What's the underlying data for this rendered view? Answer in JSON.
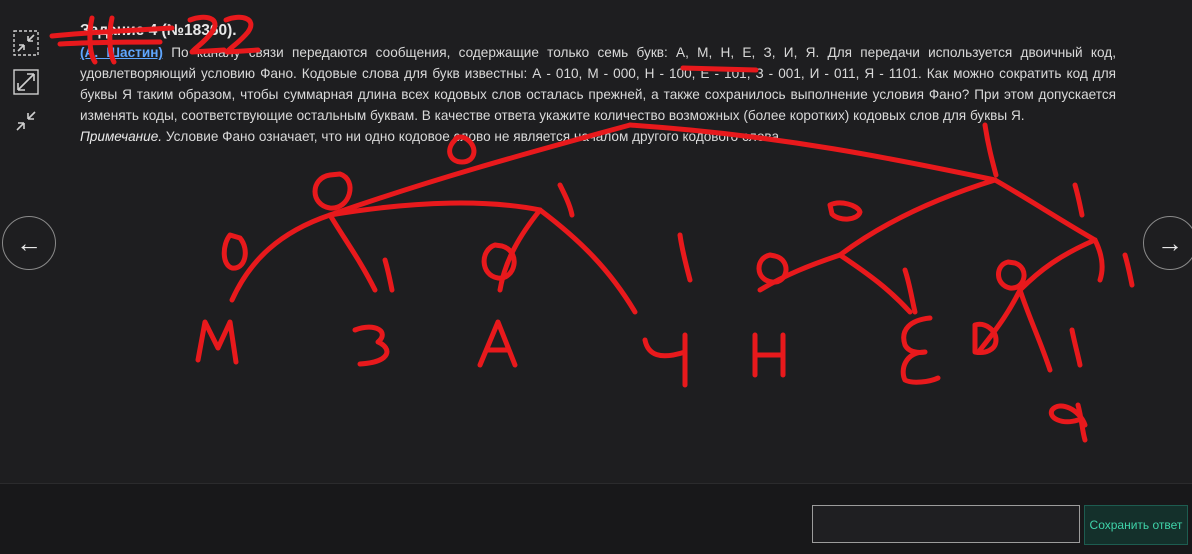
{
  "task": {
    "title": "Задание 4 (№18360).",
    "author": "(А. Шастин)",
    "text": " По каналу связи передаются сообщения, содержащие только семь букв: А, М, Н, Е, З, И, Я. Для передачи используется двоичный код, удовлетворяющий условию Фано. Кодовые слова для букв известны: А - 010, М - 000, Н - 100, Е - 101, З - 001, И - 011, Я - 1101. Как можно сократить код для буквы Я таким образом, чтобы суммарная длина всех кодовых слов осталась прежней, а также сохранилось выполнение условия Фано? При этом допускается изменять коды, соответствующие остальным буквам. В качестве ответа укажите количество возможных (более коротких) кодовых слов для буквы Я.",
    "note_label": "Примечание.",
    "note_text": " Условие Фано означает, что ни одно кодовое слово не является началом другого кодового слова."
  },
  "nav": {
    "prev": "←",
    "next": "→"
  },
  "answer": {
    "value": "",
    "placeholder": "",
    "save_label": "Сохранить ответ"
  },
  "tools": [
    "collapse-icon",
    "expand-icon",
    "shrink-icon"
  ],
  "annotations": {
    "top_left": "#22",
    "tree_labels": [
      "0",
      "1",
      "0",
      "1",
      "0",
      "1",
      "0",
      "1",
      "0",
      "1",
      "0",
      "1",
      "0",
      "1"
    ],
    "leaves": [
      "М",
      "З",
      "А",
      "И",
      "Н",
      "Е",
      "Я"
    ]
  },
  "colors": {
    "background": "#1e1e20",
    "annotation": "#e8191c",
    "link": "#5fa6ff",
    "save": "#3fd3a9"
  }
}
